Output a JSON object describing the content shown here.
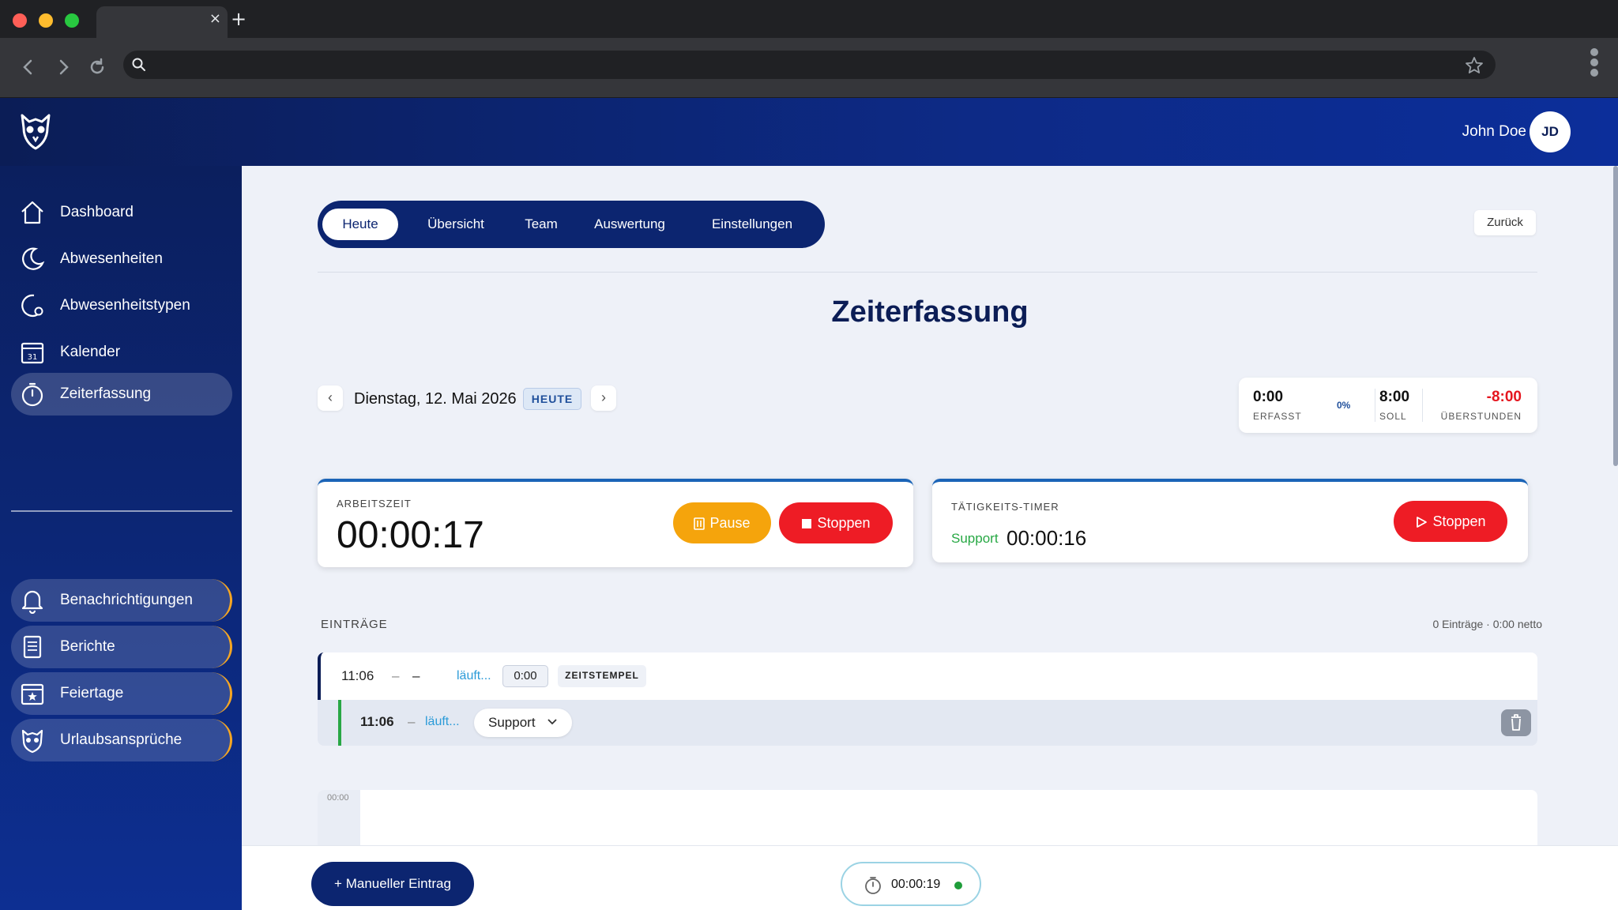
{
  "browser": {
    "tab_close": "×",
    "new_tab": "+"
  },
  "header": {
    "user_name": "John Doe",
    "avatar_initials": "JD"
  },
  "sidebar": {
    "items": [
      {
        "label": "Dashboard",
        "icon": "home-icon"
      },
      {
        "label": "Abwesenheiten",
        "icon": "moon-icon"
      },
      {
        "label": "Abwesenheitstypen",
        "icon": "moon-gear-icon"
      },
      {
        "label": "Kalender",
        "icon": "calendar-icon",
        "icon_text": "31"
      },
      {
        "label": "Zeiterfassung",
        "icon": "stopwatch-icon",
        "active": true
      }
    ],
    "bottom_items": [
      {
        "label": "Benachrichtigungen",
        "icon": "bell-icon"
      },
      {
        "label": "Berichte",
        "icon": "document-icon"
      },
      {
        "label": "Feiertage",
        "icon": "calendar-star-icon"
      },
      {
        "label": "Urlaubsansprüche",
        "icon": "owl-icon"
      }
    ]
  },
  "main": {
    "tabs": [
      {
        "label": "Heute",
        "active": true
      },
      {
        "label": "Übersicht"
      },
      {
        "label": "Team"
      },
      {
        "label": "Auswertung"
      },
      {
        "label": "Einstellungen"
      }
    ],
    "back_label": "Zurück",
    "title": "Zeiterfassung",
    "date": {
      "prev": "‹",
      "next": "›",
      "text": "Dienstag, 12. Mai 2026",
      "badge": "HEUTE"
    },
    "stats": {
      "erfasst_value": "0:00",
      "erfasst_label": "ERFASST",
      "percent": "0%",
      "soll_value": "8:00",
      "soll_label": "SOLL",
      "ueberstunden_value": "-8:00",
      "ueberstunden_label": "ÜBERSTUNDEN"
    },
    "work_card": {
      "label": "ARBEITSZEIT",
      "time": "00:00:17",
      "pause_label": "Pause",
      "stop_label": "Stoppen"
    },
    "activity_card": {
      "label": "TÄTIGKEITS-TIMER",
      "activity": "Support",
      "time": "00:00:16",
      "stop_label": "Stoppen"
    },
    "entries": {
      "heading": "EINTRÄGE",
      "summary": "0 Einträge · 0:00 netto",
      "row": {
        "start": "11:06",
        "dash": "–",
        "end": "–",
        "status": "läuft...",
        "duration": "0:00",
        "tag": "ZEITSTEMPEL"
      },
      "subrow": {
        "start": "11:06",
        "dash": "–",
        "status": "läuft...",
        "activity": "Support"
      }
    },
    "calendar": {
      "first_hour": "00:00"
    },
    "bottom": {
      "manual_label": "+ Manueller Eintrag",
      "mini_time": "00:00:19"
    }
  },
  "colors": {
    "brand_navy": "#0b1d56",
    "accent_blue": "#1b64b7",
    "pause_orange": "#f5a40c",
    "stop_red": "#ee1c25",
    "support_green": "#27a844",
    "overtime_red": "#e5161f"
  }
}
